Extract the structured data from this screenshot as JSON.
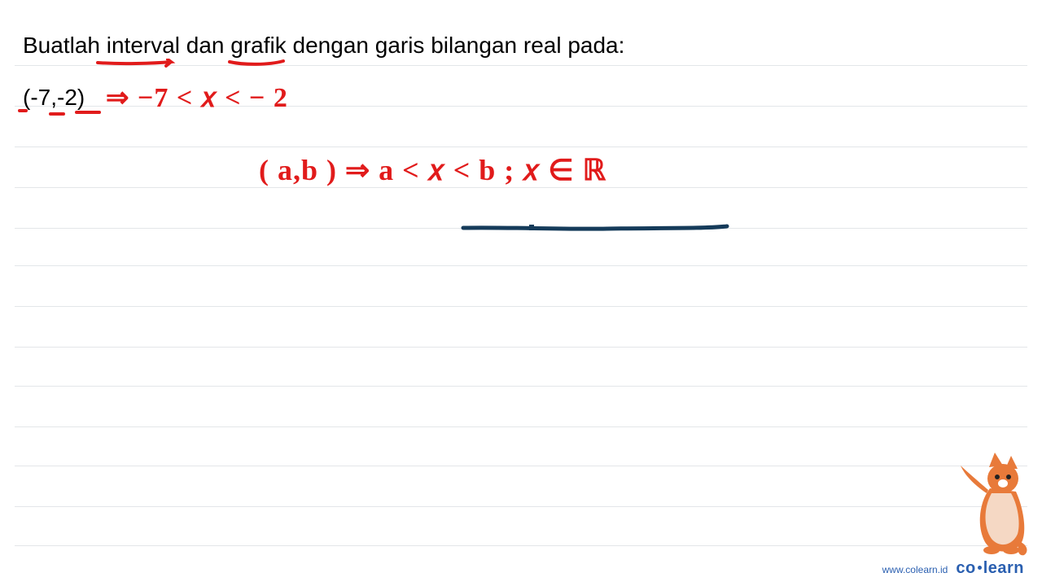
{
  "question": "Buatlah interval dan grafik dengan garis bilangan real pada:",
  "intervalText": "(-7,-2)",
  "handwriting": {
    "line1": "⇒ −7 < 𝑥 < − 2",
    "line2": "( a,b )   ⇒  a < 𝑥 < b ;  𝑥 ∈ ℝ"
  },
  "footer": {
    "site": "www.colearn.id",
    "brandPrefix": "co",
    "brandSuffix": "learn"
  },
  "ruleLines": [
    80,
    130,
    180,
    230,
    280,
    326,
    376,
    426,
    474,
    524,
    572,
    622,
    670
  ]
}
